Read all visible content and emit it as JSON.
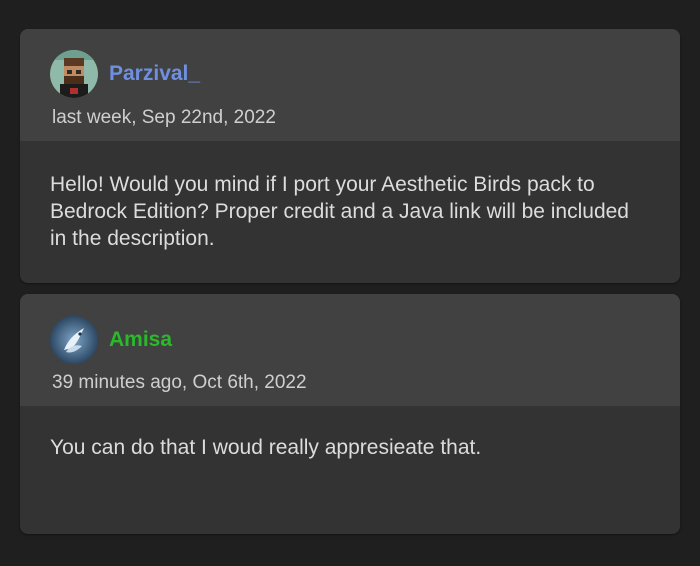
{
  "comments": [
    {
      "username": "Parzival_",
      "username_color": "#6f8fe0",
      "timestamp": "last week, Sep 22nd, 2022",
      "text": "Hello! Would you mind if I port your Aesthetic Birds pack to Bedrock Edition? Proper credit and a Java link will be included in the description."
    },
    {
      "username": "Amisa",
      "username_color": "#2bb82b",
      "timestamp": "39 minutes ago, Oct 6th, 2022",
      "text": "You can do that I woud really appresieate that."
    }
  ]
}
